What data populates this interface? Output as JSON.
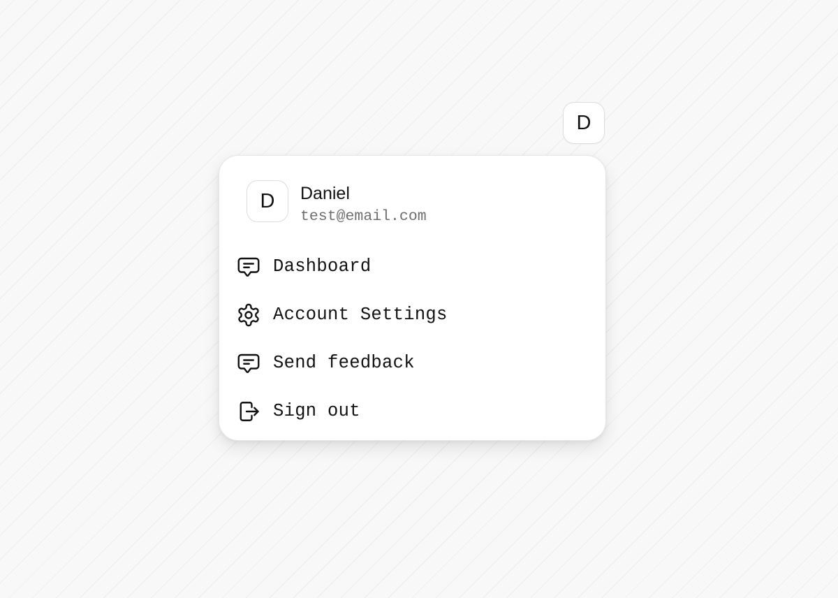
{
  "trigger": {
    "avatar_initial": "D"
  },
  "profile": {
    "avatar_initial": "D",
    "name": "Daniel",
    "email": "test@email.com"
  },
  "menu": {
    "items": [
      {
        "label": "Dashboard",
        "icon": "message-square-icon"
      },
      {
        "label": "Account Settings",
        "icon": "gear-icon"
      },
      {
        "label": "Send feedback",
        "icon": "message-square-icon"
      },
      {
        "label": "Sign out",
        "icon": "log-out-icon"
      }
    ]
  }
}
